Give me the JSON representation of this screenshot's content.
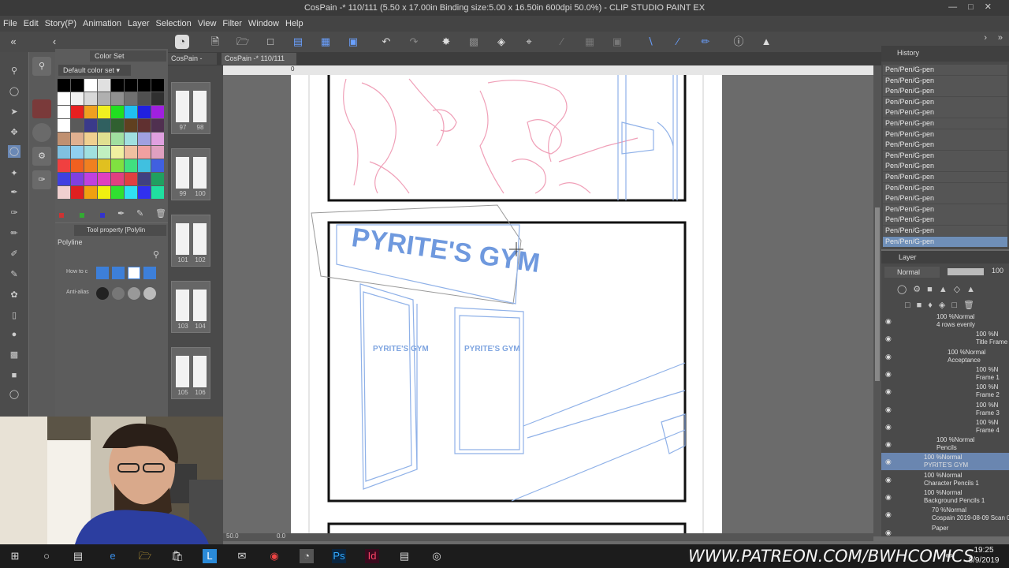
{
  "title_bar": {
    "title": "CosPain -* 110/111 (5.50 x 17.00in Binding size:5.00 x 16.50in 600dpi 50.0%) - CLIP STUDIO PAINT EX"
  },
  "menu": [
    "File",
    "Edit",
    "Story(P)",
    "Animation",
    "Layer",
    "Selection",
    "View",
    "Filter",
    "Window",
    "Help"
  ],
  "color_set": {
    "tab_label": "Color Set",
    "set_name": "Default color set"
  },
  "tool_property": {
    "tab_label": "Tool property [Polylin",
    "tool_name": "Polyline",
    "how_to_label": "How to c",
    "antialias_label": "Anti-alias"
  },
  "tabs": {
    "pages_tab": "CosPain -",
    "document_tab": "CosPain -* 110/111"
  },
  "page_labels": [
    "97",
    "98",
    "99",
    "100",
    "101",
    "102",
    "103",
    "104",
    "105",
    "106"
  ],
  "canvas": {
    "ruler_zero": "0",
    "gym_sign": "PYRITE'S GYM",
    "door_sign_left": "PYRITE'S GYM",
    "door_sign_right": "PYRITE'S GYM",
    "status_zoom": "50.0",
    "status_angle": "0.0"
  },
  "history": {
    "tab_label": "History",
    "items": [
      "Pen/Pen/G-pen",
      "Pen/Pen/G-pen",
      "Pen/Pen/G-pen",
      "Pen/Pen/G-pen",
      "Pen/Pen/G-pen",
      "Pen/Pen/G-pen",
      "Pen/Pen/G-pen",
      "Pen/Pen/G-pen",
      "Pen/Pen/G-pen",
      "Pen/Pen/G-pen",
      "Pen/Pen/G-pen",
      "Pen/Pen/G-pen",
      "Pen/Pen/G-pen",
      "Pen/Pen/G-pen",
      "Pen/Pen/G-pen",
      "Pen/Pen/G-pen",
      "Pen/Pen/G-pen"
    ]
  },
  "layers": {
    "tab_label": "Layer",
    "blend_mode": "Normal",
    "opacity": "100",
    "rows": [
      {
        "line1": "100 %Normal",
        "line2": "4 rows evenly"
      },
      {
        "line1": "100 %N",
        "line2": "Title Frame"
      },
      {
        "line1": "100 %Normal",
        "line2": "Acceptance"
      },
      {
        "line1": "100 %N",
        "line2": "Frame 1"
      },
      {
        "line1": "100 %N",
        "line2": "Frame 2"
      },
      {
        "line1": "100 %N",
        "line2": "Frame 3"
      },
      {
        "line1": "100 %N",
        "line2": "Frame 4"
      },
      {
        "line1": "100 %Normal",
        "line2": "Pencils"
      },
      {
        "line1": "100 %Normal",
        "line2": "PYRITE'S GYM"
      },
      {
        "line1": "100 %Normal",
        "line2": "Character Pencils 1"
      },
      {
        "line1": "100 %Normal",
        "line2": "Background Pencils 1"
      },
      {
        "line1": "70 %Normal",
        "line2": "Cospain 2019-08-09 Scan 00"
      },
      {
        "line1": "",
        "line2": "Paper"
      }
    ]
  },
  "taskbar": {
    "patreon_text": "WWW.PATREON.COM/BWHCOMICS",
    "time": "19:25",
    "date": "8/9/2019"
  },
  "colors": {
    "pink_pencil": "#f0a0b8",
    "blue_pencil": "#8fb1e8",
    "selected_layer": "#6a86b0",
    "history_selected": "#6f8fb8"
  }
}
